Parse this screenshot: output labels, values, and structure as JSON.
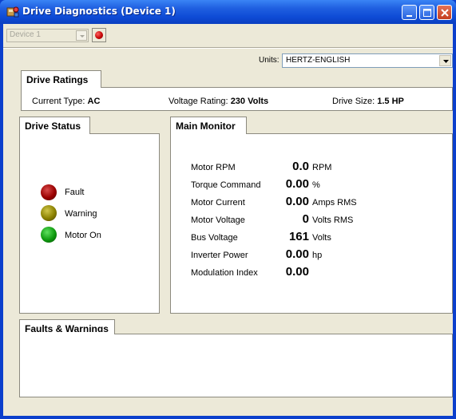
{
  "window": {
    "title": "Drive Diagnostics (Device 1)"
  },
  "device_toolbar": {
    "device_select": "Device 1"
  },
  "units": {
    "label": "Units:",
    "value": "HERTZ-ENGLISH"
  },
  "drive_ratings": {
    "tab_label": "Drive Ratings",
    "current_type_label": "Current Type:",
    "current_type_value": "AC",
    "voltage_rating_label": "Voltage Rating:",
    "voltage_rating_value": "230 Volts",
    "drive_size_label": "Drive Size:",
    "drive_size_value": "1.5 HP"
  },
  "drive_status": {
    "tab_label": "Drive Status",
    "indicators": [
      {
        "label": "Fault",
        "color": "#9a0000"
      },
      {
        "label": "Warning",
        "color": "#8a8000"
      },
      {
        "label": "Motor On",
        "color": "#0e9a0e"
      }
    ]
  },
  "main_monitor": {
    "tab_label": "Main Monitor",
    "rows": [
      {
        "label": "Motor RPM",
        "value": "0.0",
        "unit": "RPM"
      },
      {
        "label": "Torque Command",
        "value": "0.00",
        "unit": "%"
      },
      {
        "label": "Motor Current",
        "value": "0.00",
        "unit": "Amps RMS"
      },
      {
        "label": "Motor Voltage",
        "value": "0",
        "unit": "Volts RMS"
      },
      {
        "label": "Bus Voltage",
        "value": "161",
        "unit": "Volts"
      },
      {
        "label": "Inverter Power",
        "value": "0.00",
        "unit": "hp"
      },
      {
        "label": "Modulation Index",
        "value": "0.00",
        "unit": ""
      }
    ]
  },
  "faults_warnings": {
    "tab_label": "Faults & Warnings"
  }
}
